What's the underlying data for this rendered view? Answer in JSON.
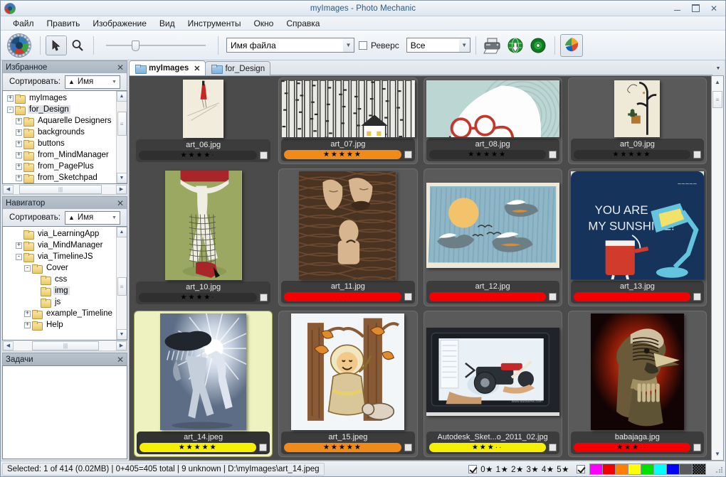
{
  "window": {
    "title": "myImages - Photo Mechanic",
    "logo_icon": "photo-mechanic-logo-icon",
    "minimize": "—",
    "maximize": "▢",
    "close": "✕"
  },
  "menubar": {
    "items": [
      "Файл",
      "Править",
      "Изображение",
      "Вид",
      "Инструменты",
      "Окно",
      "Справка"
    ]
  },
  "toolbar": {
    "logo_icon": "gear-color-wheel-icon",
    "pointer_icon": "arrow-pointer-icon",
    "zoom_icon": "magnifier-icon",
    "size_slider_value": "26",
    "sort_field": "Имя файла",
    "reverse_label": "Реверс",
    "reverse_checked": false,
    "filter": "Все",
    "print_icon": "printer-icon",
    "upload_icon": "globe-upload-icon",
    "burn_icon": "disc-burn-icon",
    "export_icon": "color-fan-export-icon"
  },
  "favorites": {
    "title": "Избранное",
    "close_icon": "close-icon",
    "sort_label": "Сортировать:",
    "sort_value": "Имя",
    "sort_dir_icon": "sort-ascending-icon",
    "tree": [
      {
        "label": "myImages",
        "depth": 0,
        "toggle": "+",
        "selected": false
      },
      {
        "label": "for_Design",
        "depth": 0,
        "toggle": "-",
        "selected": true
      },
      {
        "label": "Aquarelle Designers",
        "depth": 1,
        "toggle": "+",
        "selected": false
      },
      {
        "label": "backgrounds",
        "depth": 1,
        "toggle": "+",
        "selected": false
      },
      {
        "label": "buttons",
        "depth": 1,
        "toggle": "+",
        "selected": false
      },
      {
        "label": "from_MindManager",
        "depth": 1,
        "toggle": "+",
        "selected": false
      },
      {
        "label": "from_PagePlus",
        "depth": 1,
        "toggle": "+",
        "selected": false
      },
      {
        "label": "from_Sketchpad",
        "depth": 1,
        "toggle": "+",
        "selected": false
      }
    ]
  },
  "navigator": {
    "title": "Навигатор",
    "close_icon": "close-icon",
    "sort_label": "Сортировать:",
    "sort_value": "Имя",
    "sort_dir_icon": "sort-ascending-icon",
    "tree": [
      {
        "label": "via_LearningApp",
        "depth": 1,
        "toggle": "",
        "selected": false
      },
      {
        "label": "via_MindManager",
        "depth": 1,
        "toggle": "+",
        "selected": false
      },
      {
        "label": "via_TimelineJS",
        "depth": 1,
        "toggle": "-",
        "selected": false
      },
      {
        "label": "Cover",
        "depth": 2,
        "toggle": "-",
        "selected": false
      },
      {
        "label": "css",
        "depth": 3,
        "toggle": "",
        "selected": false
      },
      {
        "label": "img",
        "depth": 3,
        "toggle": "",
        "selected": true
      },
      {
        "label": "js",
        "depth": 3,
        "toggle": "",
        "selected": false
      },
      {
        "label": "example_Timeline",
        "depth": 2,
        "toggle": "+",
        "selected": false
      },
      {
        "label": "Help",
        "depth": 2,
        "toggle": "+",
        "selected": false
      }
    ]
  },
  "tasks": {
    "title": "Задачи",
    "close_icon": "close-icon"
  },
  "tabs": {
    "items": [
      {
        "label": "myImages",
        "active": true,
        "closable": true,
        "icon": "folder-tab-icon"
      },
      {
        "label": "for_Design",
        "active": false,
        "closable": false,
        "icon": "folder-tab-icon"
      }
    ],
    "menu_icon": "chevron-down-icon"
  },
  "grid": {
    "thumbnails": [
      {
        "filename": "art_06.jpg",
        "stars": 4,
        "star_total": 5,
        "bar_color": "#2f2f2f",
        "star_color": "#000000",
        "selected": false,
        "boxed": false,
        "art": "art06",
        "ratio": "0.70",
        "label_color": "#e9e9e9"
      },
      {
        "filename": "art_07.jpg",
        "stars": 5,
        "star_total": 5,
        "bar_color": "#f08a1b",
        "star_color": "#000000",
        "selected": false,
        "boxed": true,
        "art": "art07",
        "ratio": "1.35",
        "label_color": "#e9e9e9"
      },
      {
        "filename": "art_08.jpg",
        "stars": 5,
        "star_total": 5,
        "bar_color": "#2f2f2f",
        "star_color": "#000000",
        "selected": false,
        "boxed": true,
        "art": "art08",
        "ratio": "1.00",
        "label_color": "#e9e9e9"
      },
      {
        "filename": "art_09.jpg",
        "stars": 5,
        "star_total": 5,
        "bar_color": "#2f2f2f",
        "star_color": "#000000",
        "selected": false,
        "boxed": true,
        "art": "art09",
        "ratio": "0.80",
        "label_color": "#e9e9e9"
      },
      {
        "filename": "art_10.jpg",
        "stars": 4,
        "star_total": 5,
        "bar_color": "#2f2f2f",
        "star_color": "#000000",
        "selected": false,
        "boxed": false,
        "art": "art10",
        "ratio": "0.70",
        "label_color": "#e9e9e9"
      },
      {
        "filename": "art_11.jpg",
        "stars": 0,
        "star_total": 5,
        "bar_color": "#f50000",
        "star_color": "#8a0000",
        "selected": false,
        "boxed": true,
        "art": "art11",
        "ratio": "0.90",
        "label_color": "#e9e9e9"
      },
      {
        "filename": "art_12.jpg",
        "stars": 0,
        "star_total": 5,
        "bar_color": "#f50000",
        "star_color": "#8a0000",
        "selected": false,
        "boxed": true,
        "art": "art12",
        "ratio": "1.55",
        "label_color": "#e9e9e9"
      },
      {
        "filename": "art_13.jpg",
        "stars": 0,
        "star_total": 5,
        "bar_color": "#f50000",
        "star_color": "#8a0000",
        "selected": false,
        "boxed": true,
        "art": "art13",
        "ratio": "1.05",
        "label_color": "#e9e9e9"
      },
      {
        "filename": "art_14.jpeg",
        "stars": 5,
        "star_total": 5,
        "bar_color": "#f6f000",
        "star_color": "#000000",
        "selected": true,
        "boxed": false,
        "art": "art14",
        "ratio": "0.74",
        "label_color": "#e9e9e9"
      },
      {
        "filename": "art_15.jpeg",
        "stars": 5,
        "star_total": 5,
        "bar_color": "#f08a1b",
        "star_color": "#000000",
        "selected": false,
        "boxed": true,
        "art": "art15",
        "ratio": "0.97",
        "label_color": "#e9e9e9"
      },
      {
        "filename": "Autodesk_Sket...o_2011_02.jpg",
        "stars": 3,
        "star_total": 5,
        "bar_color": "#f6f000",
        "star_color": "#000000",
        "selected": false,
        "boxed": true,
        "art": "autodesk",
        "ratio": "1.50",
        "label_color": "#e9e9e9"
      },
      {
        "filename": "babajaga.jpg",
        "stars": 3,
        "star_total": 5,
        "bar_color": "#f50000",
        "star_color": "#000000",
        "selected": false,
        "boxed": true,
        "art": "babajaga",
        "ratio": "0.80",
        "label_color": "#e9e9e9"
      }
    ],
    "scroll_up_icon": "scroll-up-icon",
    "scroll_down_icon": "scroll-down-icon"
  },
  "statusbar": {
    "text": "Selected: 1 of 414 (0.02MB) | 0+405=405 total | 9 unknown | D:\\myImages\\art_14.jpeg",
    "star_filter_checked": true,
    "star_filter_label": "0★ 1★ 2★ 3★ 4★ 5★",
    "color_filter_checked": true,
    "color_swatches": [
      "#ff00ff",
      "#f40000",
      "#ff8000",
      "#ffff00",
      "#00e000",
      "#00ffff",
      "#0000ff",
      "#5a5a5a",
      "#2b2b2b"
    ],
    "resize_grip_icon": "resize-grip-icon"
  }
}
